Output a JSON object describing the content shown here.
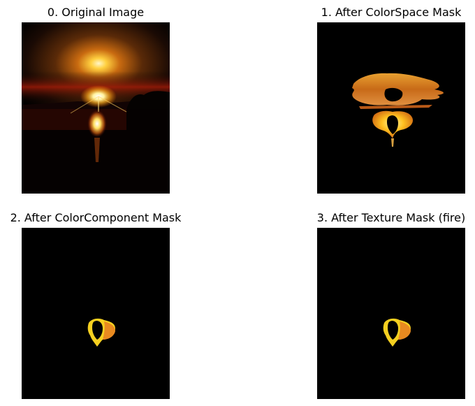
{
  "panels": [
    {
      "title": "0. Original Image"
    },
    {
      "title": "1. After ColorSpace Mask"
    },
    {
      "title": "2. After ColorComponent Mask"
    },
    {
      "title": "3. After Texture Mask (fire)"
    }
  ],
  "colors": {
    "background": "#ffffff",
    "image_black": "#000000",
    "sun_core": "#fffbe0",
    "fire_yellow": "#ffe000",
    "fire_orange": "#e07a10",
    "sky_red": "#8a1a0a"
  }
}
